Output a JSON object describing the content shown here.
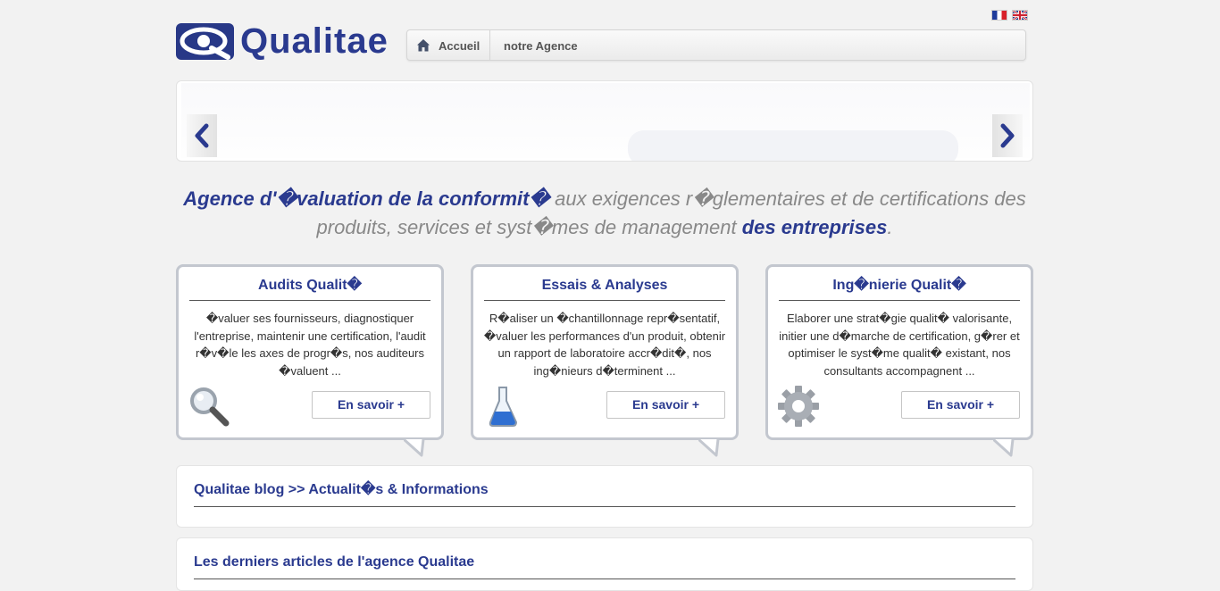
{
  "header": {
    "flags": [
      {
        "name": "flag-fr-icon",
        "lang": "Français"
      },
      {
        "name": "flag-en-icon",
        "lang": "English"
      }
    ],
    "logo_text": "Qualitae"
  },
  "nav": {
    "items": [
      {
        "label": "Accueil"
      },
      {
        "label": "notre Agence"
      }
    ]
  },
  "tagline": {
    "part1_bold": "Agence d'�valuation de la conformit�",
    "part2": " aux exigences r�glementaires et de certifications des produits, services et syst�mes de management ",
    "part3_bold": "des entreprises",
    "part4": "."
  },
  "boxes": [
    {
      "title": "Audits Qualit�",
      "text": "�valuer ses fournisseurs, diagnostiquer l'entreprise, maintenir une certification, l'audit r�v�le les axes de progr�s, nos auditeurs �valuent ...",
      "button": "En savoir +",
      "icon": "magnifier-icon"
    },
    {
      "title": "Essais & Analyses",
      "text": "R�aliser un �chantillonnage repr�sentatif, �valuer les performances d'un produit, obtenir un rapport de laboratoire accr�dit�, nos ing�nieurs d�terminent ...",
      "button": "En savoir +",
      "icon": "flask-icon"
    },
    {
      "title": "Ing�nierie Qualit�",
      "text": "Elaborer une strat�gie qualit� valorisante, initier une d�marche de certification, g�rer et optimiser le syst�me qualit� existant, nos consultants accompagnent ...",
      "button": "En savoir +",
      "icon": "gear-icon"
    }
  ],
  "panels": [
    {
      "title": "Qualitae blog >> Actualit�s & Informations"
    },
    {
      "title": "Les derniers articles de l'agence Qualitae"
    }
  ],
  "colors": {
    "brand": "#2a3a8f",
    "background": "#f2f2f2",
    "box_border": "#c3c7cf"
  }
}
